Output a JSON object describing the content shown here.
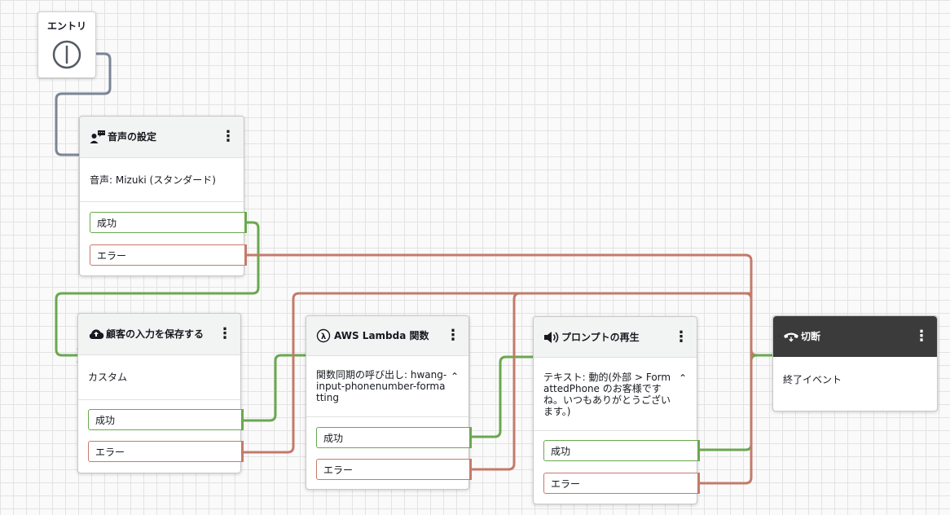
{
  "entry": {
    "label": "エントリ",
    "icon": "entry-point-icon"
  },
  "blocks": {
    "voice": {
      "title": "音声の設定",
      "icon": "voice-settings-icon",
      "body": "音声: Mizuki (スタンダード)",
      "success": "成功",
      "error": "エラー"
    },
    "store": {
      "title": "顧客の入力を保存する",
      "icon": "cloud-upload-icon",
      "body": "カスタム",
      "success": "成功",
      "error": "エラー"
    },
    "lambda": {
      "title": "AWS Lambda 関数",
      "icon": "lambda-icon",
      "body": "関数同期の呼び出し: hwang-input-phonenumber-formatting",
      "success": "成功",
      "error": "エラー"
    },
    "prompt": {
      "title": "プロンプトの再生",
      "icon": "speaker-icon",
      "body": "テキスト: 動的(外部 > FormattedPhone のお客様ですね。いつもありがとうございます。)",
      "success": "成功",
      "error": "エラー"
    },
    "disconnect": {
      "title": "切断",
      "icon": "hang-up-phone-icon",
      "body": "終了イベント"
    }
  },
  "colors": {
    "success": "#6aa84f",
    "error": "#c47a6a",
    "entry_line": "#7b8597",
    "dark_header": "#3b3b3b"
  }
}
